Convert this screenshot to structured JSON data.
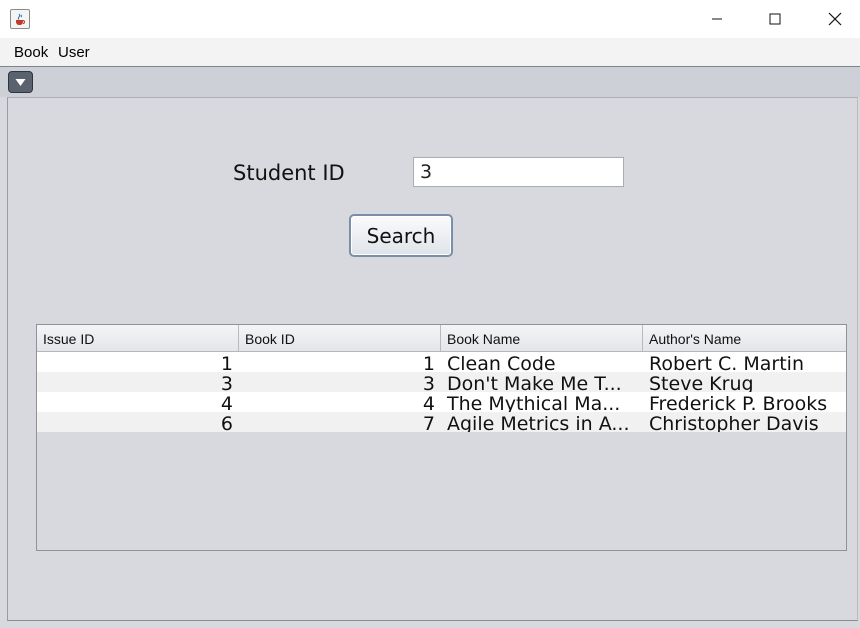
{
  "window": {
    "app_icon": "java-cup-icon",
    "controls": [
      "minimize-icon",
      "maximize-icon",
      "close-icon"
    ]
  },
  "menubar": {
    "items": [
      {
        "label": "Book"
      },
      {
        "label": "User"
      }
    ]
  },
  "toolbar": {
    "dropdown_icon": "triangle-down-icon"
  },
  "form": {
    "student_id_label": "Student ID",
    "student_id_value": "3",
    "search_label": "Search"
  },
  "table": {
    "columns": [
      "Issue ID",
      "Book ID",
      "Book Name",
      "Author's Name"
    ],
    "rows": [
      {
        "issue_id": "1",
        "book_id": "1",
        "book_name": " Clean Code",
        "author": "Robert C. Martin"
      },
      {
        "issue_id": "3",
        "book_id": "3",
        "book_name": "Don't Make Me T...",
        "author": "Steve Krug"
      },
      {
        "issue_id": "4",
        "book_id": "4",
        "book_name": " The Mythical Ma...",
        "author": "Frederick P. Brooks"
      },
      {
        "issue_id": "6",
        "book_id": "7",
        "book_name": "Agile Metrics in A...",
        "author": "Christopher Davis"
      }
    ]
  },
  "colors": {
    "panel_bg": "#d7d9de",
    "button_border": "#7b8ea9",
    "row_alt": "#f1f1f1"
  }
}
